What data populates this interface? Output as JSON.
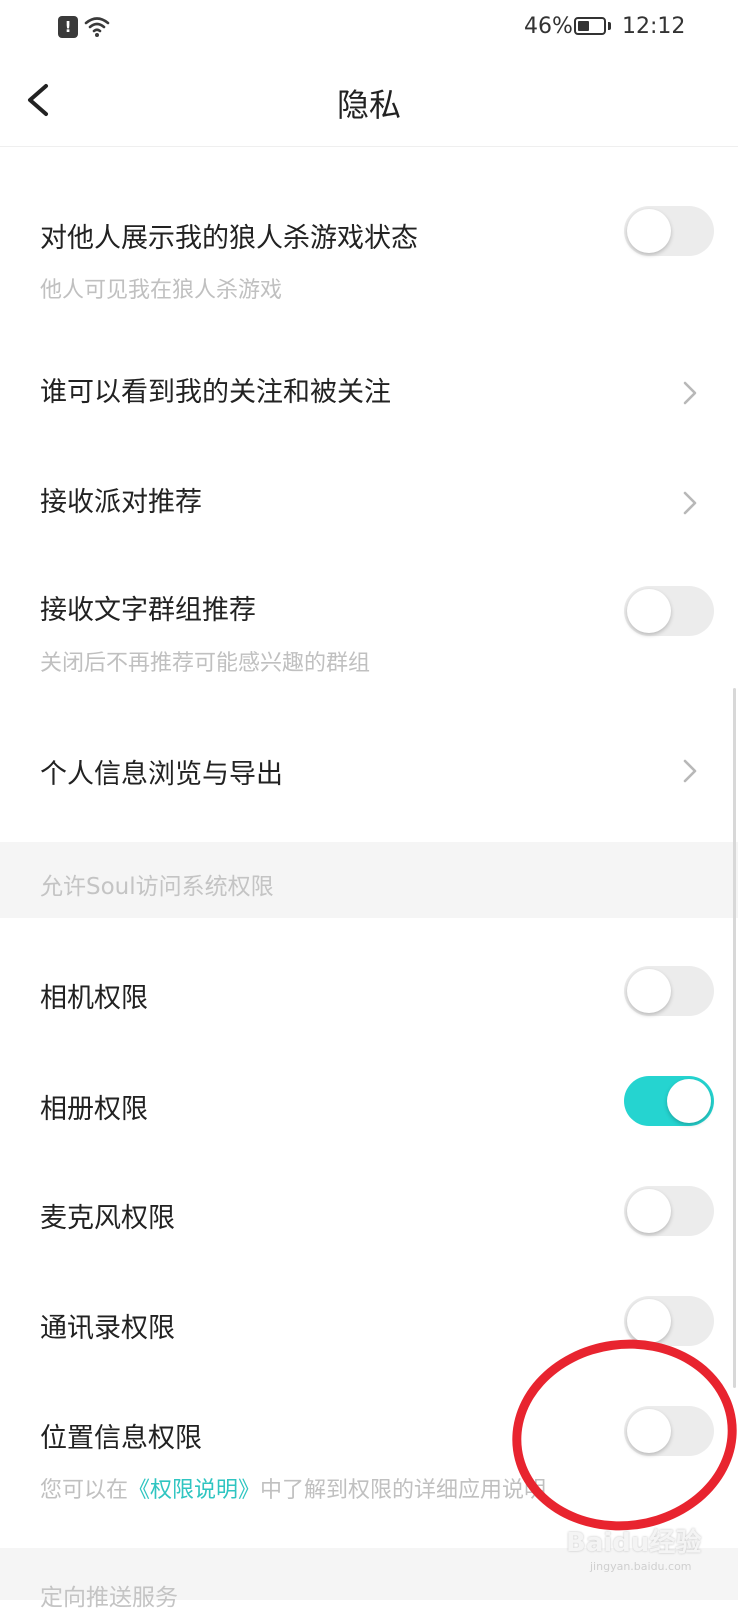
{
  "status_bar": {
    "battery_percent": "46%",
    "battery_level": 0.46,
    "time": "12:12",
    "alert_icon": "alert-icon",
    "wifi_icon": "wifi-icon"
  },
  "header": {
    "title": "隐私",
    "back_icon": "back-chevron-icon"
  },
  "settings": [
    {
      "title": "对他人展示我的狼人杀游戏状态",
      "subtitle": "他人可见我在狼人杀游戏",
      "control": "toggle",
      "on": false
    },
    {
      "title": "谁可以看到我的关注和被关注",
      "control": "chevron"
    },
    {
      "title": "接收派对推荐",
      "control": "chevron"
    },
    {
      "title": "接收文字群组推荐",
      "subtitle": "关闭后不再推荐可能感兴趣的群组",
      "control": "toggle",
      "on": false
    },
    {
      "title": "个人信息浏览与导出",
      "control": "chevron"
    }
  ],
  "permissions_section": {
    "label": "允许Soul访问系统权限",
    "items": [
      {
        "title": "相机权限",
        "on": false
      },
      {
        "title": "相册权限",
        "on": true
      },
      {
        "title": "麦克风权限",
        "on": false
      },
      {
        "title": "通讯录权限",
        "on": false
      },
      {
        "title": "位置信息权限",
        "on": false
      }
    ],
    "note_prefix": "您可以在",
    "note_link": "《权限说明》",
    "note_suffix": "中了解到权限的详细应用说明"
  },
  "next_section": {
    "label": "定向推送服务"
  },
  "watermark": {
    "text": "Baidu经验",
    "sub": "jingyan.baidu.com"
  },
  "colors": {
    "accent": "#25d4d0",
    "link": "#2fc5c1",
    "annotation_circle": "#e8242f",
    "section_bg": "#f5f5f5"
  }
}
